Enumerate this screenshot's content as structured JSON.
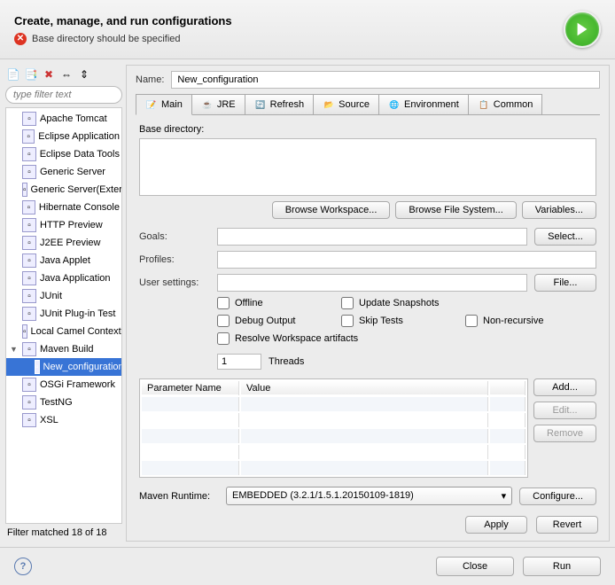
{
  "header": {
    "title": "Create, manage, and run configurations",
    "error": "Base directory should be specified"
  },
  "toolbar_icons": {
    "new": "📄",
    "dup": "📑",
    "del": "✖",
    "col": "⇔",
    "exp": "⇕"
  },
  "filter": {
    "placeholder": "type filter text"
  },
  "tree": [
    {
      "label": "Apache Tomcat"
    },
    {
      "label": "Eclipse Application"
    },
    {
      "label": "Eclipse Data Tools"
    },
    {
      "label": "Generic Server"
    },
    {
      "label": "Generic Server(External)"
    },
    {
      "label": "Hibernate Console"
    },
    {
      "label": "HTTP Preview"
    },
    {
      "label": "J2EE Preview"
    },
    {
      "label": "Java Applet"
    },
    {
      "label": "Java Application"
    },
    {
      "label": "JUnit"
    },
    {
      "label": "JUnit Plug-in Test"
    },
    {
      "label": "Local Camel Context"
    },
    {
      "label": "Maven Build",
      "expanded": true
    },
    {
      "label": "New_configuration",
      "child": true,
      "selected": true
    },
    {
      "label": "OSGi Framework"
    },
    {
      "label": "TestNG"
    },
    {
      "label": "XSL"
    }
  ],
  "filter_status": "Filter matched 18 of 18",
  "name": {
    "label": "Name:",
    "value": "New_configuration"
  },
  "tabs": [
    {
      "label": "Main",
      "active": true,
      "icon": "📝"
    },
    {
      "label": "JRE",
      "icon": "☕"
    },
    {
      "label": "Refresh",
      "icon": "🔄"
    },
    {
      "label": "Source",
      "icon": "📂"
    },
    {
      "label": "Environment",
      "icon": "🌐"
    },
    {
      "label": "Common",
      "icon": "📋"
    }
  ],
  "form": {
    "base_dir_label": "Base directory:",
    "base_dir_value": "",
    "browse_ws": "Browse Workspace...",
    "browse_fs": "Browse File System...",
    "variables": "Variables...",
    "goals_label": "Goals:",
    "select_btn": "Select...",
    "profiles_label": "Profiles:",
    "user_settings_label": "User settings:",
    "file_btn": "File...",
    "checkboxes": {
      "offline": "Offline",
      "update": "Update Snapshots",
      "debug": "Debug Output",
      "skip": "Skip Tests",
      "nonrec": "Non-recursive",
      "resolve": "Resolve Workspace artifacts"
    },
    "threads_value": "1",
    "threads_label": "Threads",
    "table_cols": {
      "param": "Parameter Name",
      "value": "Value"
    },
    "add_btn": "Add...",
    "edit_btn": "Edit...",
    "remove_btn": "Remove",
    "runtime_label": "Maven Runtime:",
    "runtime_value": "EMBEDDED (3.2.1/1.5.1.20150109-1819)",
    "configure_btn": "Configure..."
  },
  "footer": {
    "apply": "Apply",
    "revert": "Revert"
  },
  "dialog": {
    "close": "Close",
    "run": "Run"
  }
}
